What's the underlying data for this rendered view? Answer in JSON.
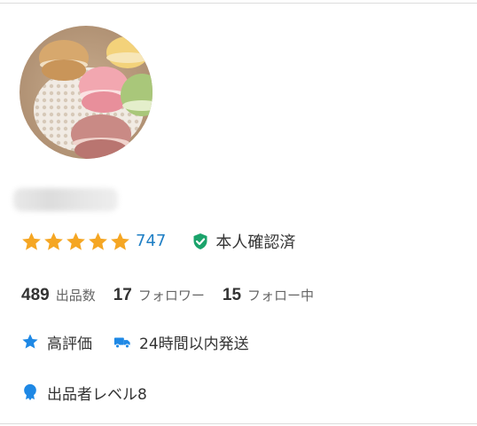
{
  "profile": {
    "avatar_icon": "macaron-photo-avatar",
    "rating": {
      "stars": 5,
      "star_color": "#f5a623",
      "review_count": "747",
      "review_color": "#1f7fc5"
    },
    "identity": {
      "label": "本人確認済",
      "icon": "verified-shield-icon",
      "color": "#1aa36b"
    },
    "stats": [
      {
        "value": "489",
        "label": "出品数"
      },
      {
        "value": "17",
        "label": "フォロワー"
      },
      {
        "value": "15",
        "label": "フォロー中"
      }
    ],
    "badges": [
      {
        "icon": "star-icon",
        "label": "高評価",
        "color": "#1e88e5"
      },
      {
        "icon": "truck-icon",
        "label": "24時間以内発送",
        "color": "#1e88e5"
      }
    ],
    "level": {
      "icon": "medal-icon",
      "label": "出品者レベル8",
      "color": "#1e88e5"
    }
  }
}
